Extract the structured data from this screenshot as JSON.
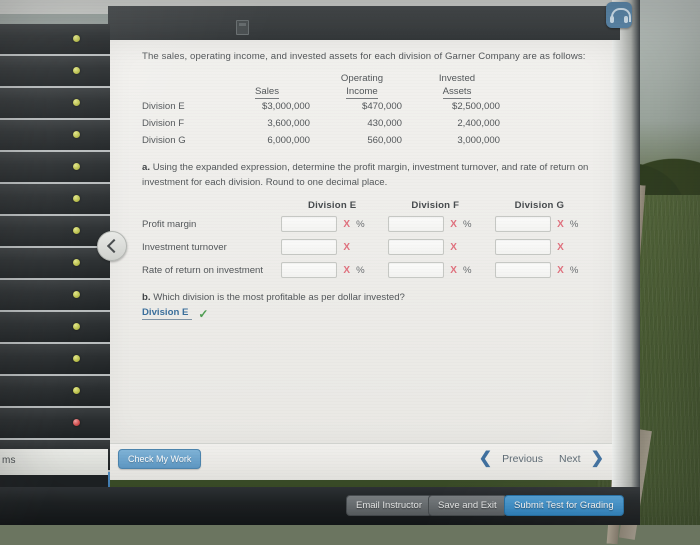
{
  "background": {
    "scene": "outdoor-grass-with-wooden-post",
    "grass_color": "#41532b",
    "post_color": "#9b9183"
  },
  "browser": {
    "help_icon": "headset-support-icon",
    "tab_icon": "page-icon"
  },
  "navigator": {
    "collapse_icon": "chevron-left-icon",
    "footer_label": "ms",
    "rows": [
      {
        "status": "answered"
      },
      {
        "status": "answered"
      },
      {
        "status": "answered"
      },
      {
        "status": "answered"
      },
      {
        "status": "answered"
      },
      {
        "status": "answered"
      },
      {
        "status": "answered"
      },
      {
        "status": "answered"
      },
      {
        "status": "answered"
      },
      {
        "status": "answered"
      },
      {
        "status": "answered"
      },
      {
        "status": "answered"
      },
      {
        "status": "incorrect"
      },
      {
        "status": "answered"
      },
      {
        "status": "current"
      }
    ]
  },
  "question": {
    "intro": "The sales, operating income, and invested assets for each division of Garner Company are as follows:",
    "table": {
      "headers": {
        "col1_line1": "",
        "col1_line2": "Sales",
        "col2_line1": "Operating",
        "col2_line2": "Income",
        "col3_line1": "Invested",
        "col3_line2": "Assets"
      },
      "rows": [
        {
          "division": "Division E",
          "sales": "$3,000,000",
          "operating_income": "$470,000",
          "invested_assets": "$2,500,000"
        },
        {
          "division": "Division F",
          "sales": "3,600,000",
          "operating_income": "430,000",
          "invested_assets": "2,400,000"
        },
        {
          "division": "Division G",
          "sales": "6,000,000",
          "operating_income": "560,000",
          "invested_assets": "3,000,000"
        }
      ]
    },
    "part_a": {
      "marker": "a.",
      "text": "Using the expanded expression, determine the profit margin, investment turnover, and rate of return on investment for each division. Round to one decimal place.",
      "column_headers": [
        "Division E",
        "Division F",
        "Division G"
      ],
      "rows": [
        {
          "label": "Profit margin",
          "cells": [
            {
              "value": "",
              "mark": "X",
              "unit": "%"
            },
            {
              "value": "",
              "mark": "X",
              "unit": "%"
            },
            {
              "value": "",
              "mark": "X",
              "unit": "%"
            }
          ]
        },
        {
          "label": "Investment turnover",
          "cells": [
            {
              "value": "",
              "mark": "X",
              "unit": ""
            },
            {
              "value": "",
              "mark": "X",
              "unit": ""
            },
            {
              "value": "",
              "mark": "X",
              "unit": ""
            }
          ]
        },
        {
          "label": "Rate of return on investment",
          "cells": [
            {
              "value": "",
              "mark": "X",
              "unit": "%"
            },
            {
              "value": "",
              "mark": "X",
              "unit": "%"
            },
            {
              "value": "",
              "mark": "X",
              "unit": "%"
            }
          ]
        }
      ]
    },
    "part_b": {
      "marker": "b.",
      "text": "Which division is the most profitable as per dollar invested?",
      "answer": "Division E",
      "answer_mark": "check-icon"
    }
  },
  "footer": {
    "check_my_work": "Check My Work",
    "previous": "Previous",
    "next": "Next",
    "prev_icon": "chevron-left-icon",
    "next_icon": "chevron-right-icon"
  },
  "action_bar": {
    "email_instructor": "Email Instructor",
    "save_and_exit": "Save and Exit",
    "submit_test": "Submit Test for Grading",
    "submit_color": "#2f86c4"
  }
}
